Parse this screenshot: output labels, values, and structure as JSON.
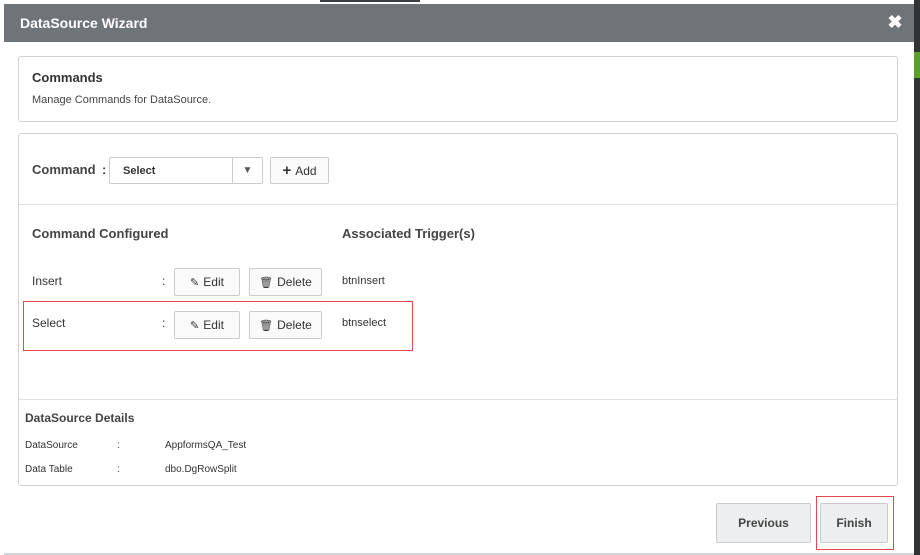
{
  "dialog": {
    "title": "DataSource Wizard",
    "close_glyph": "✖"
  },
  "commands_panel": {
    "title": "Commands",
    "description": "Manage Commands for DataSource."
  },
  "command_select": {
    "label": "Command",
    "colon": ":",
    "selected_value": "Select",
    "caret_glyph": "▼",
    "add_label": "Add",
    "add_icon_glyph": "+"
  },
  "table": {
    "col_configured": "Command Configured",
    "col_triggers": "Associated Trigger(s)",
    "edit_label": "Edit",
    "delete_label": "Delete",
    "edit_icon_glyph": "✎",
    "delete_icon_glyph": "🗑",
    "colon": ":",
    "rows": [
      {
        "name": "Insert",
        "trigger": "btnInsert"
      },
      {
        "name": "Select",
        "trigger": "btnselect"
      }
    ]
  },
  "details": {
    "title": "DataSource Details",
    "colon": ":",
    "datasource_label": "DataSource",
    "datasource_value": "AppformsQA_Test",
    "datatable_label": "Data Table",
    "datatable_value": "dbo.DgRowSplit"
  },
  "footer": {
    "previous_label": "Previous",
    "finish_label": "Finish"
  },
  "colors": {
    "titlebar": "#6f7479",
    "highlight": "#e8474c",
    "panel_border": "#cfd3d6"
  }
}
